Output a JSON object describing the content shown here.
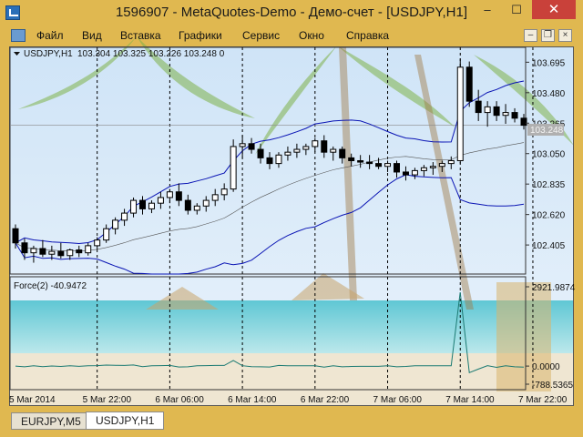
{
  "window": {
    "title": "1596907 - MetaQuotes-Demo - Демо-счет - [USDJPY,H1]",
    "min_glyph": "–",
    "max_glyph": "☐",
    "close_glyph": "✕"
  },
  "menu": {
    "items": [
      "Файл",
      "Вид",
      "Вставка",
      "Графики",
      "Сервис",
      "Окно",
      "Справка"
    ],
    "mdi_glyphs": [
      "–",
      "❐",
      "×"
    ]
  },
  "chart": {
    "symbol_label": "USDJPY,H1",
    "ohlc_label": "103.304 103.325 103.226 103.248 0",
    "indicator_label": "Force(2) -40.9472",
    "current_price": "103.248",
    "colors": {
      "band": "#0a14b4",
      "candle_up": "#ffffff",
      "candle_down": "#000000",
      "force": "#1a7a72",
      "grid": "#000000"
    }
  },
  "tabs": [
    {
      "label": "EURJPY,M5",
      "active": false
    },
    {
      "label": "USDJPY,H1",
      "active": true
    }
  ],
  "chart_data": {
    "type": "candlestick",
    "price_axis": {
      "ticks": [
        102.405,
        102.62,
        102.835,
        103.05,
        103.265,
        103.48,
        103.695
      ],
      "tick_labels": [
        "102.405",
        "102.620",
        "102.835",
        "103.050",
        "103.265",
        "103.480",
        "103.695"
      ],
      "range": [
        102.2,
        103.8
      ]
    },
    "force_axis": {
      "tick_labels": [
        "2921.9874",
        "0.0000",
        "-788.5365"
      ],
      "range": [
        -788.5365,
        2921.9874
      ]
    },
    "time_axis": {
      "labels": [
        "5 Mar 2014",
        "5 Mar 22:00",
        "6 Mar 06:00",
        "6 Mar 14:00",
        "6 Mar 22:00",
        "7 Mar 06:00",
        "7 Mar 14:00",
        "7 Mar 22:00"
      ],
      "label_bar_index": [
        0,
        9,
        17,
        25,
        33,
        41,
        49,
        57
      ]
    },
    "candles": [
      [
        102.52,
        102.55,
        102.38,
        102.42
      ],
      [
        102.42,
        102.45,
        102.3,
        102.35
      ],
      [
        102.35,
        102.4,
        102.28,
        102.38
      ],
      [
        102.38,
        102.44,
        102.32,
        102.34
      ],
      [
        102.34,
        102.4,
        102.3,
        102.36
      ],
      [
        102.36,
        102.42,
        102.31,
        102.33
      ],
      [
        102.33,
        102.38,
        102.3,
        102.37
      ],
      [
        102.37,
        102.4,
        102.32,
        102.35
      ],
      [
        102.35,
        102.42,
        102.33,
        102.4
      ],
      [
        102.4,
        102.46,
        102.37,
        102.44
      ],
      [
        102.44,
        102.55,
        102.42,
        102.52
      ],
      [
        102.52,
        102.6,
        102.48,
        102.58
      ],
      [
        102.58,
        102.66,
        102.54,
        102.63
      ],
      [
        102.63,
        102.74,
        102.6,
        102.72
      ],
      [
        102.72,
        102.75,
        102.62,
        102.66
      ],
      [
        102.66,
        102.72,
        102.63,
        102.7
      ],
      [
        102.7,
        102.78,
        102.66,
        102.74
      ],
      [
        102.74,
        102.8,
        102.7,
        102.78
      ],
      [
        102.78,
        102.84,
        102.68,
        102.72
      ],
      [
        102.72,
        102.76,
        102.62,
        102.65
      ],
      [
        102.65,
        102.7,
        102.62,
        102.68
      ],
      [
        102.68,
        102.75,
        102.64,
        102.72
      ],
      [
        102.72,
        102.8,
        102.68,
        102.76
      ],
      [
        102.76,
        102.84,
        102.72,
        102.8
      ],
      [
        102.8,
        103.15,
        102.78,
        103.1
      ],
      [
        103.1,
        103.18,
        103.02,
        103.12
      ],
      [
        103.12,
        103.16,
        103.05,
        103.08
      ],
      [
        103.08,
        103.12,
        102.98,
        103.02
      ],
      [
        103.02,
        103.06,
        102.94,
        102.98
      ],
      [
        102.98,
        103.06,
        102.95,
        103.04
      ],
      [
        103.04,
        103.1,
        103.0,
        103.06
      ],
      [
        103.06,
        103.12,
        103.02,
        103.08
      ],
      [
        103.08,
        103.12,
        103.04,
        103.1
      ],
      [
        103.1,
        103.16,
        103.06,
        103.14
      ],
      [
        103.14,
        103.18,
        103.02,
        103.06
      ],
      [
        103.06,
        103.1,
        103.0,
        103.08
      ],
      [
        103.08,
        103.1,
        102.98,
        103.02
      ],
      [
        103.02,
        103.05,
        102.96,
        103.0
      ],
      [
        103.0,
        103.04,
        102.95,
        102.99
      ],
      [
        102.99,
        103.04,
        102.94,
        102.98
      ],
      [
        102.98,
        103.02,
        102.94,
        102.96
      ],
      [
        102.96,
        103.0,
        102.92,
        102.98
      ],
      [
        102.98,
        103.0,
        102.88,
        102.92
      ],
      [
        102.92,
        102.96,
        102.86,
        102.9
      ],
      [
        102.9,
        102.95,
        102.87,
        102.93
      ],
      [
        102.93,
        102.97,
        102.89,
        102.95
      ],
      [
        102.95,
        102.99,
        102.9,
        102.96
      ],
      [
        102.96,
        103.0,
        102.92,
        102.98
      ],
      [
        102.98,
        103.03,
        102.94,
        103.0
      ],
      [
        103.0,
        103.72,
        102.98,
        103.66
      ],
      [
        103.66,
        103.7,
        103.38,
        103.42
      ],
      [
        103.42,
        103.5,
        103.28,
        103.34
      ],
      [
        103.34,
        103.42,
        103.24,
        103.38
      ],
      [
        103.38,
        103.42,
        103.28,
        103.32
      ],
      [
        103.32,
        103.4,
        103.26,
        103.34
      ],
      [
        103.34,
        103.37,
        103.27,
        103.3
      ],
      [
        103.3,
        103.33,
        103.22,
        103.25
      ]
    ],
    "bollinger_period": 20,
    "bollinger_deviation": 2,
    "force_values": [
      0,
      -30,
      10,
      -20,
      5,
      -15,
      10,
      -10,
      15,
      20,
      40,
      30,
      25,
      45,
      -25,
      15,
      20,
      25,
      -35,
      -30,
      10,
      20,
      25,
      25,
      220,
      15,
      -20,
      -30,
      -35,
      25,
      15,
      10,
      10,
      15,
      -40,
      10,
      -30,
      -15,
      -10,
      -10,
      -12,
      10,
      -30,
      -15,
      15,
      10,
      10,
      10,
      15,
      2921.9874,
      -260,
      -120,
      20,
      -50,
      15,
      -30,
      -41
    ]
  }
}
